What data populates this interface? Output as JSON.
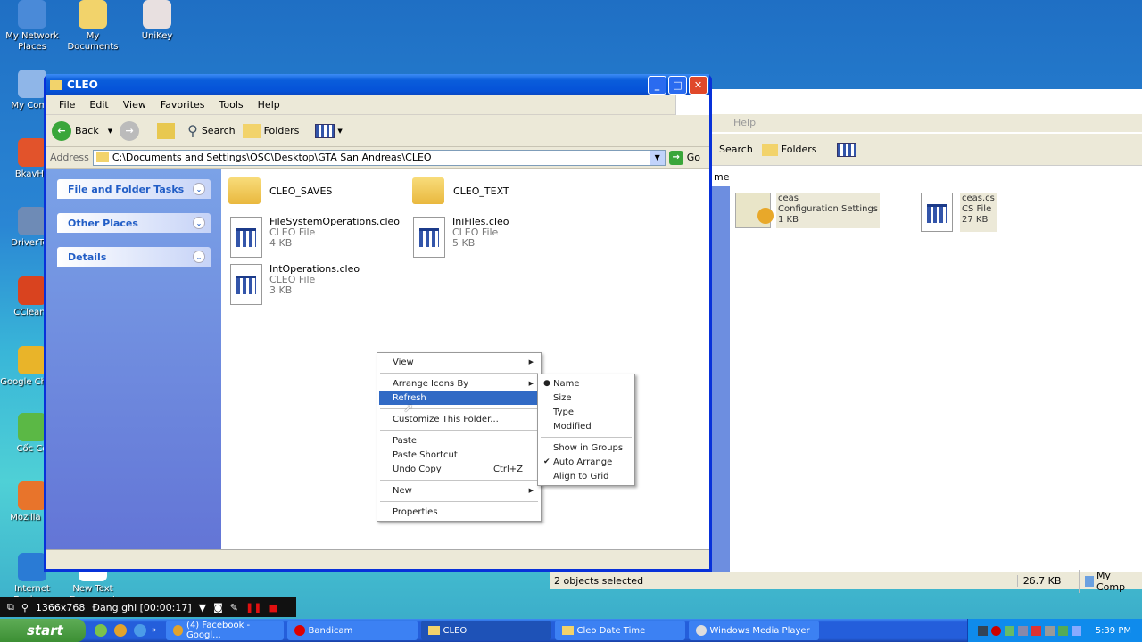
{
  "desktop": {
    "icons": [
      {
        "label": "My Network Places",
        "icon": "network-icon",
        "color": "#4a8ad8"
      },
      {
        "label": "My Documents",
        "icon": "documents-folder-icon",
        "color": "#f2d36b"
      },
      {
        "label": "UniKey",
        "icon": "unikey-icon",
        "color": "#e8e0e0"
      },
      {
        "label": "My Comp",
        "icon": "computer-icon",
        "color": "#8fb6e8"
      },
      {
        "label": "BkavHo",
        "icon": "bkav-shield-icon",
        "color": "#e2532b"
      },
      {
        "label": "DriverToo",
        "icon": "tools-icon",
        "color": "#6e8bb6"
      },
      {
        "label": "CCleane",
        "icon": "ccleaner-icon",
        "color": "#d9431f"
      },
      {
        "label": "Google Chrom",
        "icon": "chrome-icon",
        "color": "#e9b429"
      },
      {
        "label": "Cốc Cố",
        "icon": "coccoc-icon",
        "color": "#5bb845"
      },
      {
        "label": "Mozilla Fir",
        "icon": "firefox-icon",
        "color": "#e8742b"
      },
      {
        "label": "Internet Explorer",
        "icon": "ie-icon",
        "color": "#2a7bd5"
      },
      {
        "label": "New Text Document",
        "icon": "text-doc-icon",
        "color": "#ffffff"
      }
    ]
  },
  "window": {
    "title": "CLEO",
    "menu": [
      "File",
      "Edit",
      "View",
      "Favorites",
      "Tools",
      "Help"
    ],
    "toolbar": {
      "back": "Back",
      "search": "Search",
      "folders": "Folders"
    },
    "address": {
      "label": "Address",
      "value": "C:\\Documents and Settings\\OSC\\Desktop\\GTA San Andreas\\CLEO",
      "go": "Go"
    },
    "panels": [
      "File and Folder Tasks",
      "Other Places",
      "Details"
    ],
    "items": [
      {
        "name": "CLEO_SAVES",
        "kind": "folder"
      },
      {
        "name": "CLEO_TEXT",
        "kind": "folder"
      },
      {
        "name": "FileSystemOperations.cleo",
        "type": "CLEO File",
        "size": "4 KB",
        "kind": "file"
      },
      {
        "name": "IniFiles.cleo",
        "type": "CLEO File",
        "size": "5 KB",
        "kind": "file"
      },
      {
        "name": "IntOperations.cleo",
        "type": "CLEO File",
        "size": "3 KB",
        "kind": "file"
      }
    ]
  },
  "context_menu": {
    "items": [
      "View",
      "Arrange Icons By",
      "Refresh",
      "Customize This Folder...",
      "Paste",
      "Paste Shortcut",
      "Undo Copy",
      "New",
      "Properties"
    ],
    "undo_shortcut": "Ctrl+Z",
    "highlighted": "Refresh"
  },
  "submenu": {
    "items": [
      "Name",
      "Size",
      "Type",
      "Modified",
      "Show in Groups",
      "Auto Arrange",
      "Align to Grid"
    ],
    "selected": "Name",
    "checked": "Auto Arrange"
  },
  "background_window": {
    "menu_partial": "Help",
    "search": "Search",
    "folders": "Folders",
    "addr_partial": "me",
    "items": [
      {
        "name": "ceas",
        "type": "Configuration Settings",
        "size": "1 KB"
      },
      {
        "name": "ceas.cs",
        "type": "CS File",
        "size": "27 KB"
      }
    ],
    "status": "2 objects selected",
    "status_size": "26.7 KB",
    "status_location": "My Comp"
  },
  "bandicam": {
    "resolution": "1366x768",
    "recording": "Đang ghi [00:00:17]"
  },
  "taskbar": {
    "start": "start",
    "tasks": [
      "(4) Facebook - Googl...",
      "Bandicam",
      "CLEO",
      "Cleo Date Time",
      "Windows Media Player"
    ],
    "active": "CLEO",
    "clock": "5:39 PM"
  }
}
